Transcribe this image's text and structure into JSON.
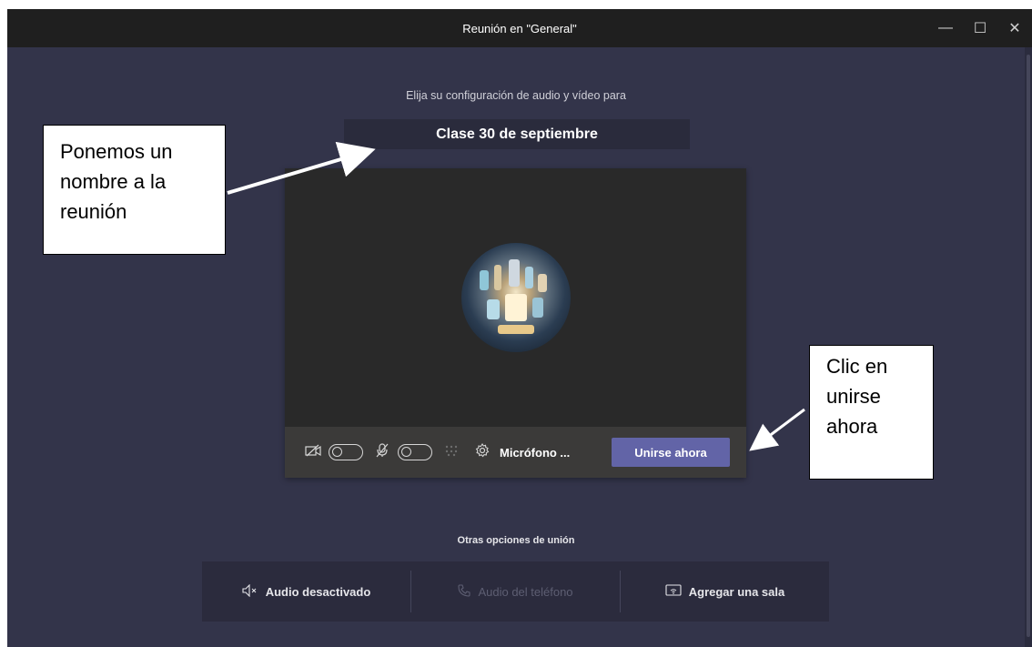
{
  "window": {
    "title": "Reunión en \"General\"",
    "controls": {
      "minimize": "—",
      "maximize": "☐",
      "close": "✕"
    }
  },
  "prejoin": {
    "subtitle": "Elija su configuración de audio y vídeo para",
    "meeting_name": "Clase 30 de septiembre",
    "device_label": "Micrófono ...",
    "join_button": "Unirse ahora",
    "camera_on": false,
    "microphone_on": false
  },
  "other_options": {
    "title": "Otras opciones de unión",
    "items": [
      {
        "label": "Audio desactivado",
        "icon": "speaker-mute-icon",
        "enabled": true
      },
      {
        "label": "Audio del teléfono",
        "icon": "phone-icon",
        "enabled": false
      },
      {
        "label": "Agregar una sala",
        "icon": "cast-screen-icon",
        "enabled": true
      }
    ]
  },
  "annotations": {
    "callout_name": [
      "Ponemos un",
      "nombre a la",
      "reunión"
    ],
    "callout_join": [
      "Clic en",
      "unirse",
      "ahora"
    ]
  },
  "colors": {
    "background": "#33344a",
    "titlebar": "#1f1f1f",
    "join_button": "#6264a7",
    "preview": "#292929",
    "controls_bar": "#3b3a39"
  }
}
